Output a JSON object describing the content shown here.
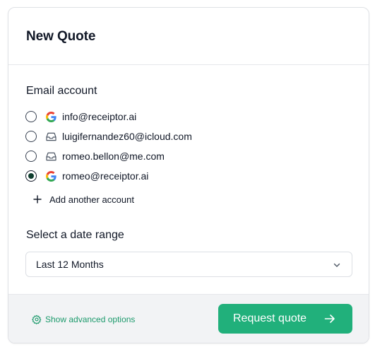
{
  "header": {
    "title": "New Quote"
  },
  "email_section": {
    "label": "Email account",
    "accounts": [
      {
        "email": "info@receiptor.ai",
        "icon": "google-icon",
        "selected": false
      },
      {
        "email": "luigifernandez60@icloud.com",
        "icon": "inbox-icon",
        "selected": false
      },
      {
        "email": "romeo.bellon@me.com",
        "icon": "inbox-icon",
        "selected": false
      },
      {
        "email": "romeo@receiptor.ai",
        "icon": "google-icon",
        "selected": true
      }
    ],
    "add_label": "Add another account"
  },
  "date_section": {
    "label": "Select a date range",
    "selected": "Last 12 Months"
  },
  "footer": {
    "advanced_label": "Show advanced options",
    "submit_label": "Request quote"
  },
  "colors": {
    "accent": "#21b07b",
    "link": "#1d9a6c",
    "radio_fill": "#0f3d2e",
    "footer_bg": "#f2f3f5"
  }
}
